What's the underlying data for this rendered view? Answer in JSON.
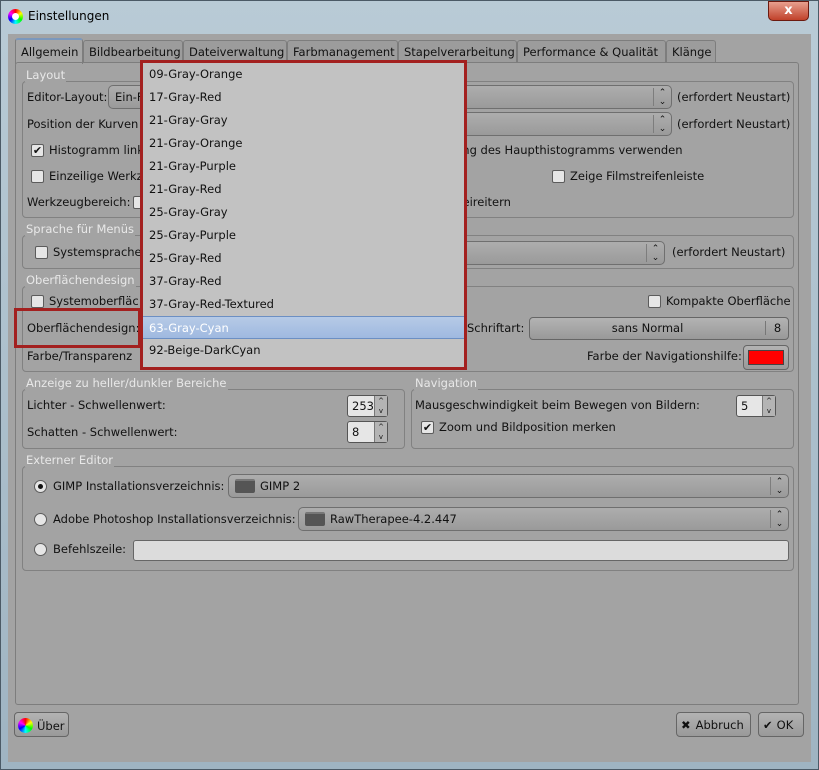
{
  "window": {
    "title": "Einstellungen",
    "close": "x"
  },
  "tabs": [
    {
      "label": "Allgemein"
    },
    {
      "label": "Bildbearbeitung"
    },
    {
      "label": "Dateiverwaltung"
    },
    {
      "label": "Farbmanagement"
    },
    {
      "label": "Stapelverarbeitung"
    },
    {
      "label": "Performance & Qualität"
    },
    {
      "label": "Klänge"
    }
  ],
  "layout": {
    "legend": "Layout",
    "editor_label": "Editor-Layout:",
    "editor_value": "Ein-F",
    "restart": "(erfordert Neustart)",
    "curves_label": "Position der Kurven",
    "histogram_left": "Histogramm link",
    "histogram_right": "ung des Haupthistogramms verwenden",
    "histogram_checked": true,
    "single_row": "Einzeilige Werkz",
    "filmstrip": "Zeige Filmstreifenleiste",
    "toolarea_label": "Werkzeugbereich:",
    "toolarea_right": "teireitern"
  },
  "language": {
    "legend": "Sprache für Menüs",
    "system": "Systemsprache",
    "restart": "(erfordert Neustart)"
  },
  "theme": {
    "legend": "Oberflächendesign",
    "system": "Systemoberfläc",
    "compact": "Kompakte Oberfläche",
    "design_label": "Oberflächendesign:",
    "font_label": "Schriftart:",
    "font_value": "sans Normal",
    "font_size": "8",
    "color_label": "Farbe/Transparenz",
    "nav_color_label": "Farbe der Navigationshilfe:",
    "nav_color": "#ff0000",
    "overlay_color": "#333333"
  },
  "clipping": {
    "legend": "Anzeige zu heller/dunkler Bereiche",
    "highlights_label": "Lichter - Schwellenwert:",
    "highlights": "253",
    "shadows_label": "Schatten - Schwellenwert:",
    "shadows": "8"
  },
  "navigation": {
    "legend": "Navigation",
    "speed_label": "Mausgeschwindigkeit beim Bewegen von Bildern:",
    "speed": "5",
    "remember": "Zoom und Bildposition merken",
    "remember_checked": true
  },
  "external": {
    "legend": "Externer Editor",
    "gimp_label": "GIMP Installationsverzeichnis:",
    "gimp_value": "GIMP 2",
    "ps_label": "Adobe Photoshop Installationsverzeichnis:",
    "ps_value": "RawTherapee-4.2.447",
    "cmd_label": "Befehlszeile:",
    "cmd_value": "",
    "selected": "gimp"
  },
  "footer": {
    "about": "Über",
    "cancel": "Abbruch",
    "ok": "OK"
  },
  "dropdown": {
    "selected": "63-Gray-Cyan",
    "items": [
      "09-Gray-Orange",
      "17-Gray-Red",
      "21-Gray-Gray",
      "21-Gray-Orange",
      "21-Gray-Purple",
      "21-Gray-Red",
      "25-Gray-Gray",
      "25-Gray-Purple",
      "25-Gray-Red",
      "37-Gray-Red",
      "37-Gray-Red-Textured",
      "63-Gray-Cyan",
      "92-Beige-DarkCyan"
    ]
  }
}
